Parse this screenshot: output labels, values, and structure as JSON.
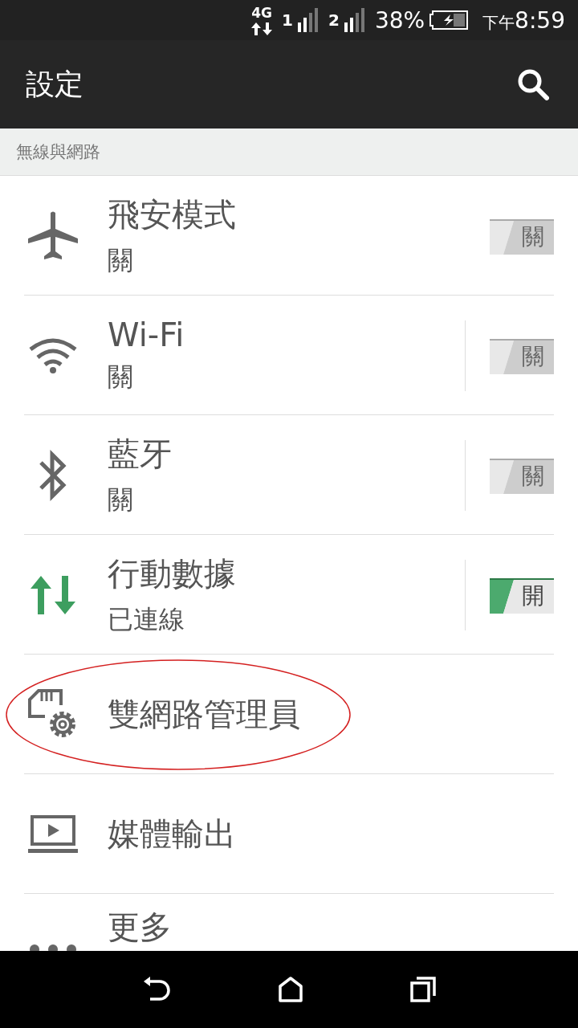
{
  "status_bar": {
    "network": "4G",
    "sim_1": "1",
    "sim_2": "2",
    "battery": "38%",
    "time_prefix": "下午",
    "time": "8:59"
  },
  "app_bar": {
    "title": "設定"
  },
  "section": "無線與網路",
  "items": [
    {
      "title": "飛安模式",
      "subtitle": "關",
      "kind": "toggle",
      "split": false,
      "on": false,
      "toggle_label": "關",
      "circled": false
    },
    {
      "title": "Wi-Fi",
      "subtitle": "關",
      "kind": "toggle",
      "split": true,
      "on": false,
      "toggle_label": "關",
      "circled": false
    },
    {
      "title": "藍牙",
      "subtitle": "關",
      "kind": "toggle",
      "split": true,
      "on": false,
      "toggle_label": "關",
      "circled": false
    },
    {
      "title": "行動數據",
      "subtitle": "已連線",
      "kind": "toggle",
      "split": true,
      "on": true,
      "toggle_label": "開",
      "circled": false
    },
    {
      "title": "雙網路管理員",
      "kind": "link",
      "circled": true
    },
    {
      "title": "媒體輸出",
      "kind": "link",
      "circled": false
    },
    {
      "title": "更多",
      "kind": "link",
      "circled": false
    }
  ]
}
